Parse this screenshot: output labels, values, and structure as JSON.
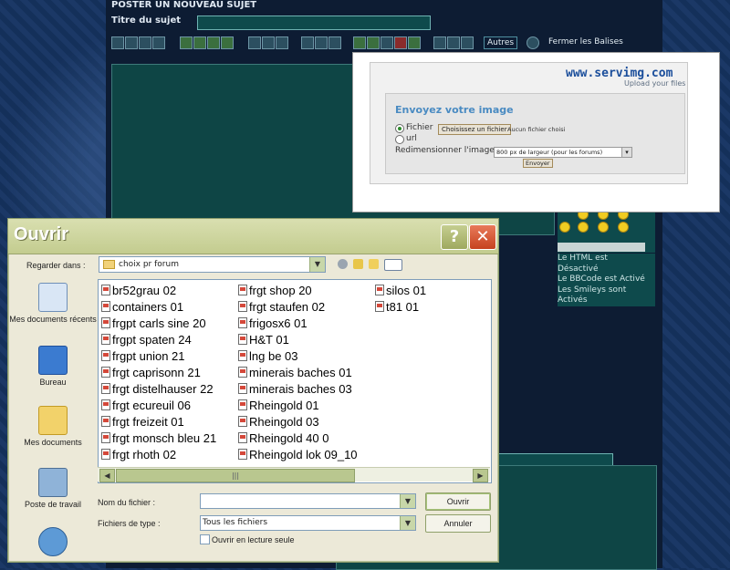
{
  "forum": {
    "title": "POSTER UN NOUVEAU SUJET",
    "subject_label": "Titre du sujet",
    "subject_value": "",
    "toolbar": {
      "autres_label": "Autres",
      "close_tags_label": "Fermer les Balises"
    },
    "info_lines": [
      "Le HTML est",
      "Désactivé",
      "Le BBCode est Activé",
      "Les Smileys sont",
      "Activés"
    ]
  },
  "servimg": {
    "logo": "www.servimg.com",
    "tagline": "Upload your files",
    "heading": "Envoyez votre image",
    "option_file": "Fichier",
    "option_url": "url",
    "choose_button": "Choisissez un fichier",
    "no_file": "Aucun fichier choisi",
    "resize_label": "Redimensionner l'image",
    "resize_value": "800 px de largeur (pour les forums)",
    "submit_label": "Envoyer"
  },
  "dialog": {
    "title": "Ouvrir",
    "help_label": "?",
    "close_label": "✕",
    "look_in_label": "Regarder dans :",
    "look_in_value": "choix pr forum",
    "places": [
      "Mes documents récents",
      "Bureau",
      "Mes documents",
      "Poste de travail",
      ""
    ],
    "files_col1": [
      "br52grau 02",
      "containers 01",
      "frgpt carls sine 20",
      "frgpt spaten 24",
      "frgpt union 21",
      "frgt caprisonn 21",
      "frgt distelhauser 22",
      "frgt ecureuil 06",
      "frgt freizeit 01",
      "frgt monsch bleu 21",
      "frgt rhoth 02"
    ],
    "files_col2": [
      "frgt shop 20",
      "frgt staufen 02",
      "frigosx6 01",
      "H&T 01",
      "lng be 03",
      "minerais baches 01",
      "minerais baches 03",
      "Rheingold 01",
      "Rheingold 03",
      "Rheingold 40 0",
      "Rheingold lok 09_10"
    ],
    "files_col3": [
      "silos 01",
      "t81 01"
    ],
    "scroll_grip": "|||",
    "filename_label": "Nom du fichier :",
    "filename_value": "",
    "filetype_label": "Fichiers de type :",
    "filetype_value": "Tous les fichiers",
    "open_button": "Ouvrir",
    "cancel_button": "Annuler",
    "readonly_label": "Ouvrir en lecture seule"
  }
}
